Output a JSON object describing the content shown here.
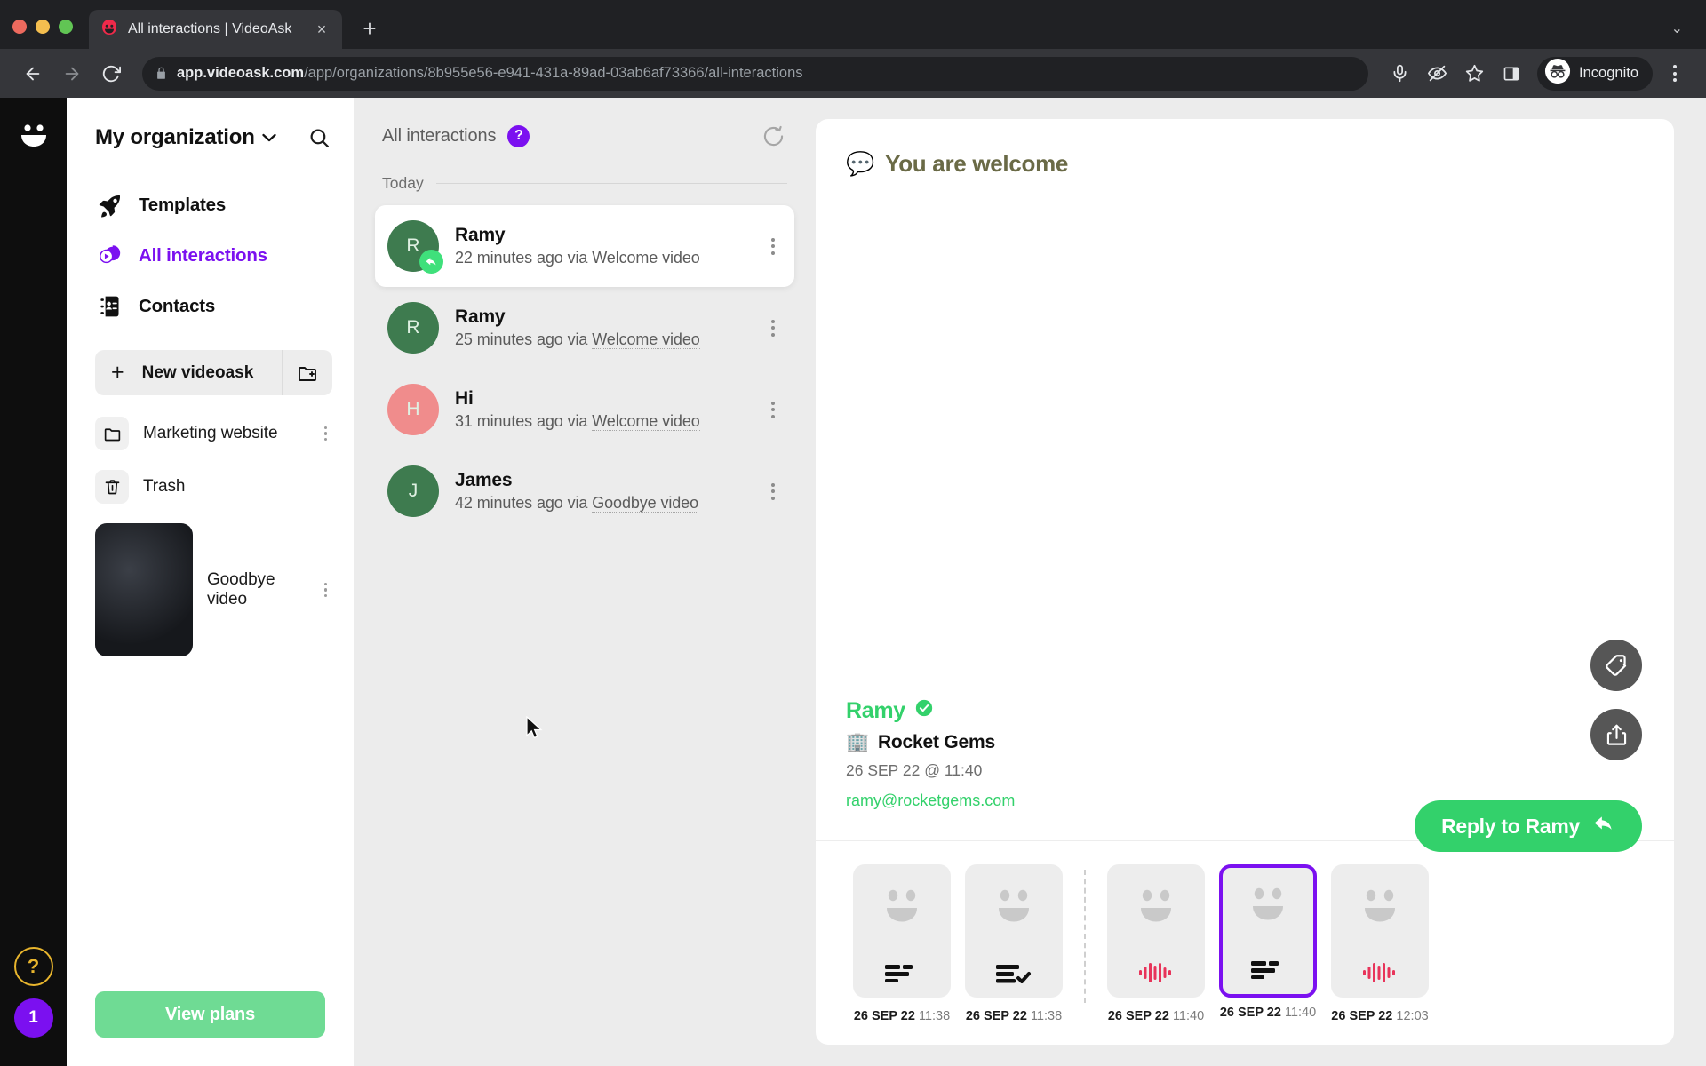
{
  "browser": {
    "tab": {
      "title": "All interactions | VideoAsk",
      "favicon": "videoask-smiley-icon",
      "close": "×"
    },
    "newtab_label": "+",
    "tabstrip_chevron": "⌄",
    "url": {
      "host": "app.videoask.com",
      "path": "/app/organizations/8b955e56-e941-431a-89ad-03ab6af73366/all-interactions"
    },
    "profile": {
      "label": "Incognito"
    },
    "icons": [
      "microphone-icon",
      "eye-off-icon",
      "star-icon",
      "side-panel-icon",
      "incognito-icon",
      "kebab-menu-icon"
    ]
  },
  "rail": {
    "logo": "videoask-logo",
    "help_label": "?",
    "badge_count": "1"
  },
  "sidebar": {
    "org": {
      "name": "My organization",
      "chevron": "⌄"
    },
    "search_icon": "search-icon",
    "nav": [
      {
        "label": "Templates",
        "icon": "rocket-icon",
        "active": false
      },
      {
        "label": "All interactions",
        "icon": "interactions-icon",
        "active": true
      },
      {
        "label": "Contacts",
        "icon": "contacts-icon",
        "active": false
      }
    ],
    "new_videoask": {
      "label": "New videoask",
      "plus": "+",
      "folder_icon": "new-folder-icon"
    },
    "folders": [
      {
        "label": "Marketing website",
        "icon": "folder-icon"
      },
      {
        "label": "Trash",
        "icon": "trash-icon"
      },
      {
        "label": "Goodbye video",
        "icon": "video-thumbnail-icon"
      }
    ],
    "view_plans_label": "View plans"
  },
  "list": {
    "title": "All interactions",
    "help_badge": "?",
    "refresh_icon": "refresh-icon",
    "group_label": "Today",
    "items": [
      {
        "initial": "R",
        "name": "Ramy",
        "time": "22 minutes ago",
        "via_prefix": "via ",
        "via": "Welcome video",
        "color": "green",
        "selected": true,
        "replied": true
      },
      {
        "initial": "R",
        "name": "Ramy",
        "time": "25 minutes ago",
        "via_prefix": "via ",
        "via": "Welcome video",
        "color": "green",
        "selected": false,
        "replied": false
      },
      {
        "initial": "H",
        "name": "Hi",
        "time": "31 minutes ago",
        "via_prefix": "via ",
        "via": "Welcome video",
        "color": "red",
        "selected": false,
        "replied": false
      },
      {
        "initial": "J",
        "name": "James",
        "time": "42 minutes ago",
        "via_prefix": "via ",
        "via": "Goodbye video",
        "color": "green",
        "selected": false,
        "replied": false
      }
    ]
  },
  "detail": {
    "title": "You are welcome",
    "title_emoji": "💬",
    "tag_button": "tag-icon",
    "share_button": "share-icon",
    "reply_label": "Reply to Ramy",
    "reply_icon": "reply-arrow-icon",
    "contact": {
      "name": "Ramy",
      "verified_icon": "verified-check-icon",
      "org_emoji": "🏢",
      "org": "Rocket Gems",
      "date": "26 SEP 22 @ 11:40",
      "email": "ramy@rocketgems.com"
    },
    "thumbnails": [
      {
        "date": "26 SEP 22",
        "time": "11:38",
        "badge": "text-lines-icon",
        "active": false
      },
      {
        "date": "26 SEP 22",
        "time": "11:38",
        "badge": "checklist-icon",
        "active": false
      },
      {
        "date": "26 SEP 22",
        "time": "11:40",
        "badge": "audio-wave-icon",
        "active": false
      },
      {
        "date": "26 SEP 22",
        "time": "11:40",
        "badge": "text-lines-icon",
        "active": true
      },
      {
        "date": "26 SEP 22",
        "time": "12:03",
        "badge": "audio-wave-icon",
        "active": false
      }
    ]
  },
  "colors": {
    "purple": "#7B10F0",
    "green": "#33D16B",
    "light_green": "#6FDB94",
    "avatar_green": "#3E7B4F",
    "avatar_red": "#F08C8C",
    "yellow": "#E8B52D",
    "title_olive": "#6A6A46",
    "audio_red": "#E8345A"
  }
}
